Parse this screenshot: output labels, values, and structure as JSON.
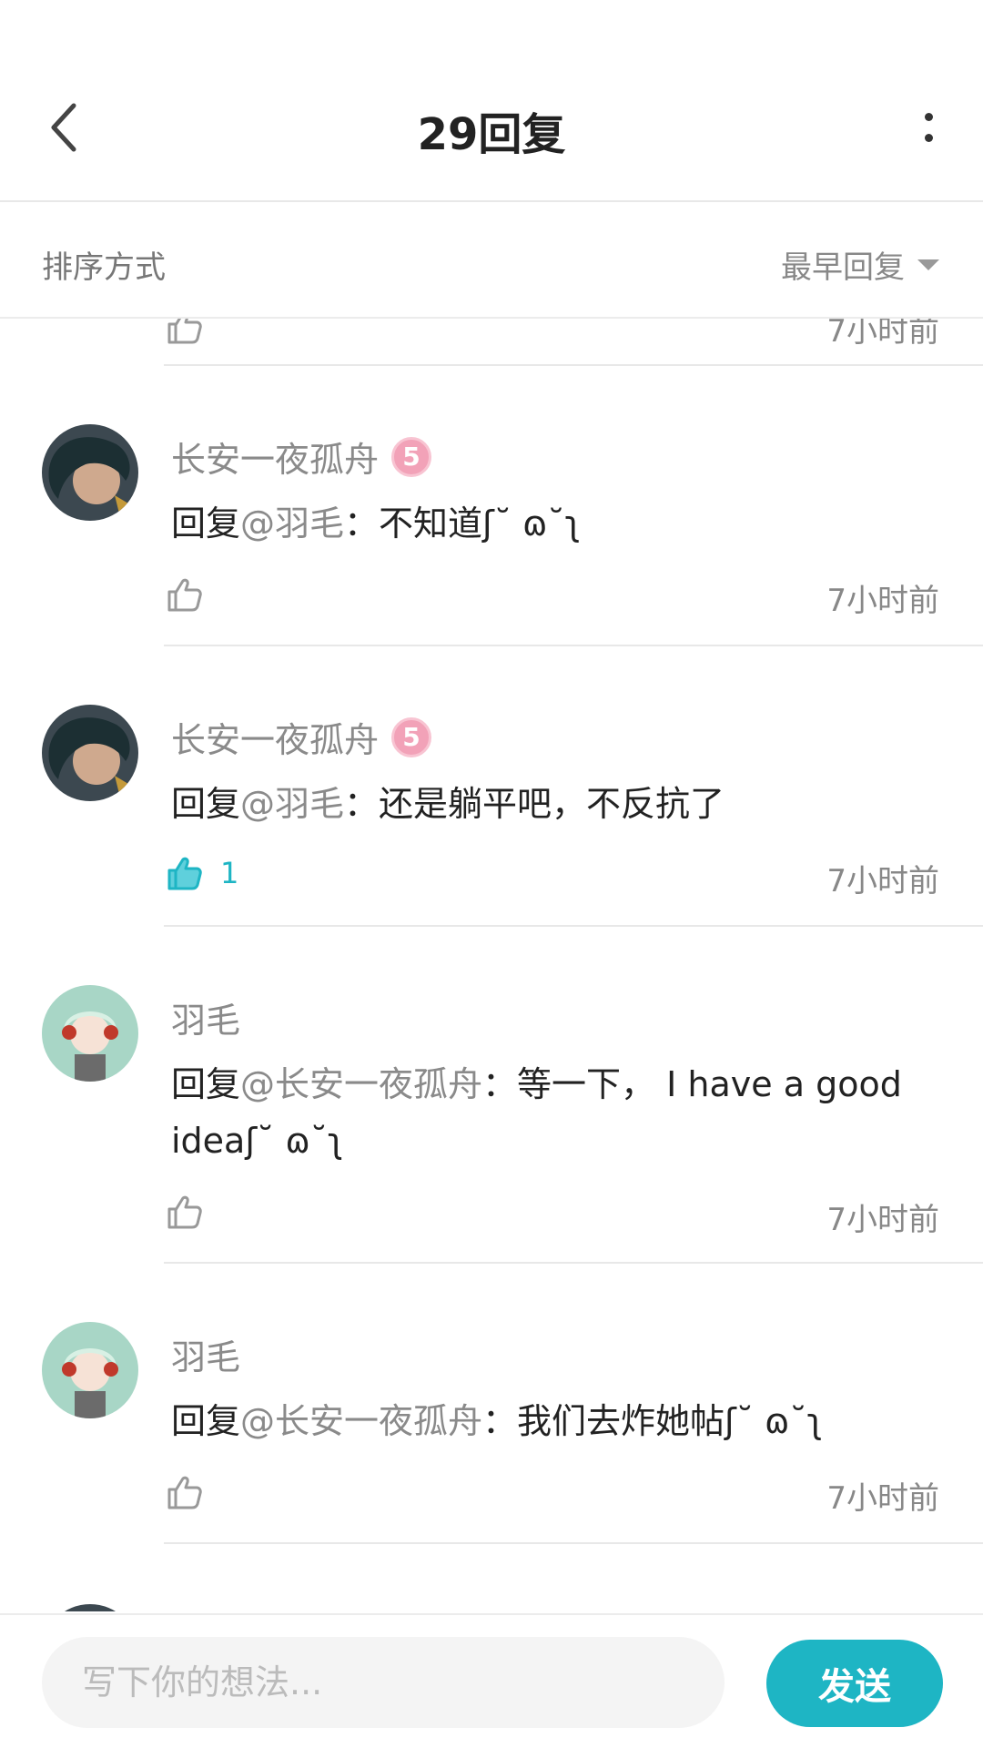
{
  "header": {
    "title": "29回复"
  },
  "sort": {
    "label": "排序方式",
    "selected": "最早回复"
  },
  "partial_top": {
    "time": "7小时前"
  },
  "replies": [
    {
      "username": "长安一夜孤舟",
      "badge": "5",
      "prefix": "回复",
      "mention": "@羽毛",
      "sep": "：",
      "body": "不知道ʃ˘ ɷ˘ʅ",
      "likes": "",
      "liked": false,
      "time": "7小时前"
    },
    {
      "username": "长安一夜孤舟",
      "badge": "5",
      "prefix": "回复",
      "mention": "@羽毛",
      "sep": "：",
      "body": "还是躺平吧，不反抗了",
      "likes": "1",
      "liked": true,
      "time": "7小时前"
    },
    {
      "username": "羽毛",
      "badge": "",
      "prefix": "回复",
      "mention": "@长安一夜孤舟",
      "sep": "：",
      "body": "等一下， I have a good ideaʃ˘ ɷ˘ʅ",
      "likes": "",
      "liked": false,
      "time": "7小时前"
    },
    {
      "username": "羽毛",
      "badge": "",
      "prefix": "回复",
      "mention": "@长安一夜孤舟",
      "sep": "：",
      "body": "我们去炸她帖ʃ˘ ɷ˘ʅ",
      "likes": "",
      "liked": false,
      "time": "7小时前"
    }
  ],
  "composer": {
    "placeholder": "写下你的想法...",
    "send_label": "发送"
  },
  "colors": {
    "accent": "#1eb5c4",
    "badge": "#f2a2b8"
  }
}
